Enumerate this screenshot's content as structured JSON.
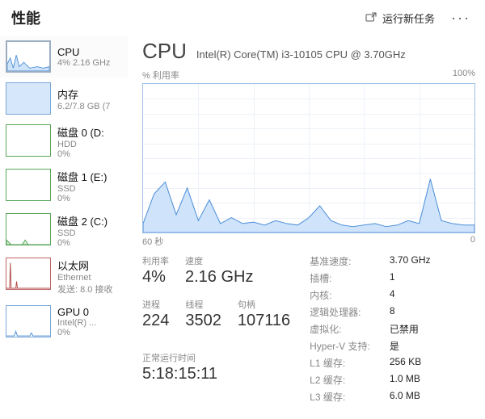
{
  "header": {
    "title": "性能",
    "run_task_label": "运行新任务",
    "more": "···"
  },
  "sidebar": {
    "items": [
      {
        "name": "CPU",
        "sub": "4% 2.16 GHz",
        "sub2": ""
      },
      {
        "name": "内存",
        "sub": "6.2/7.8 GB (7",
        "sub2": ""
      },
      {
        "name": "磁盘 0 (D:",
        "sub": "HDD",
        "sub2": "0%"
      },
      {
        "name": "磁盘 1 (E:)",
        "sub": "SSD",
        "sub2": "0%"
      },
      {
        "name": "磁盘 2 (C:)",
        "sub": "SSD",
        "sub2": "0%"
      },
      {
        "name": "以太网",
        "sub": "Ethernet",
        "sub2": "发送: 8.0 接收"
      },
      {
        "name": "GPU 0",
        "sub": "Intel(R) ...",
        "sub2": "0%"
      }
    ]
  },
  "detail": {
    "title": "CPU",
    "model": "Intel(R) Core(TM) i3-10105 CPU @ 3.70GHz",
    "yaxis_label": "% 利用率",
    "ymax": "100%",
    "x_left": "60 秒",
    "x_right": "0",
    "metrics": {
      "util_label": "利用率",
      "util_value": "4%",
      "speed_label": "速度",
      "speed_value": "2.16 GHz",
      "proc_label": "进程",
      "proc_value": "224",
      "thr_label": "线程",
      "thr_value": "3502",
      "handle_label": "句柄",
      "handle_value": "107116",
      "uptime_label": "正常运行时间",
      "uptime_value": "5:18:15:11"
    },
    "info": [
      {
        "k": "基准速度:",
        "v": "3.70 GHz"
      },
      {
        "k": "插槽:",
        "v": "1"
      },
      {
        "k": "内核:",
        "v": "4"
      },
      {
        "k": "逻辑处理器:",
        "v": "8"
      },
      {
        "k": "虚拟化:",
        "v": "已禁用"
      },
      {
        "k": "Hyper-V 支持:",
        "v": "是"
      },
      {
        "k": "L1 缓存:",
        "v": "256 KB"
      },
      {
        "k": "L2 缓存:",
        "v": "1.0 MB"
      },
      {
        "k": "L3 缓存:",
        "v": "6.0 MB"
      }
    ]
  },
  "chart_data": {
    "type": "area",
    "title": "% 利用率",
    "xlabel": "秒",
    "ylabel": "% 利用率",
    "ylim": [
      0,
      100
    ],
    "xlim": [
      60,
      0
    ],
    "x": [
      60,
      58,
      56,
      54,
      52,
      50,
      48,
      46,
      44,
      42,
      40,
      38,
      36,
      34,
      32,
      30,
      28,
      26,
      24,
      22,
      20,
      18,
      16,
      14,
      12,
      10,
      8,
      6,
      4,
      2,
      0
    ],
    "values": [
      6,
      26,
      34,
      12,
      30,
      8,
      22,
      6,
      10,
      6,
      7,
      5,
      8,
      6,
      5,
      10,
      18,
      8,
      5,
      4,
      5,
      6,
      4,
      5,
      8,
      6,
      36,
      8,
      6,
      5,
      5
    ]
  }
}
